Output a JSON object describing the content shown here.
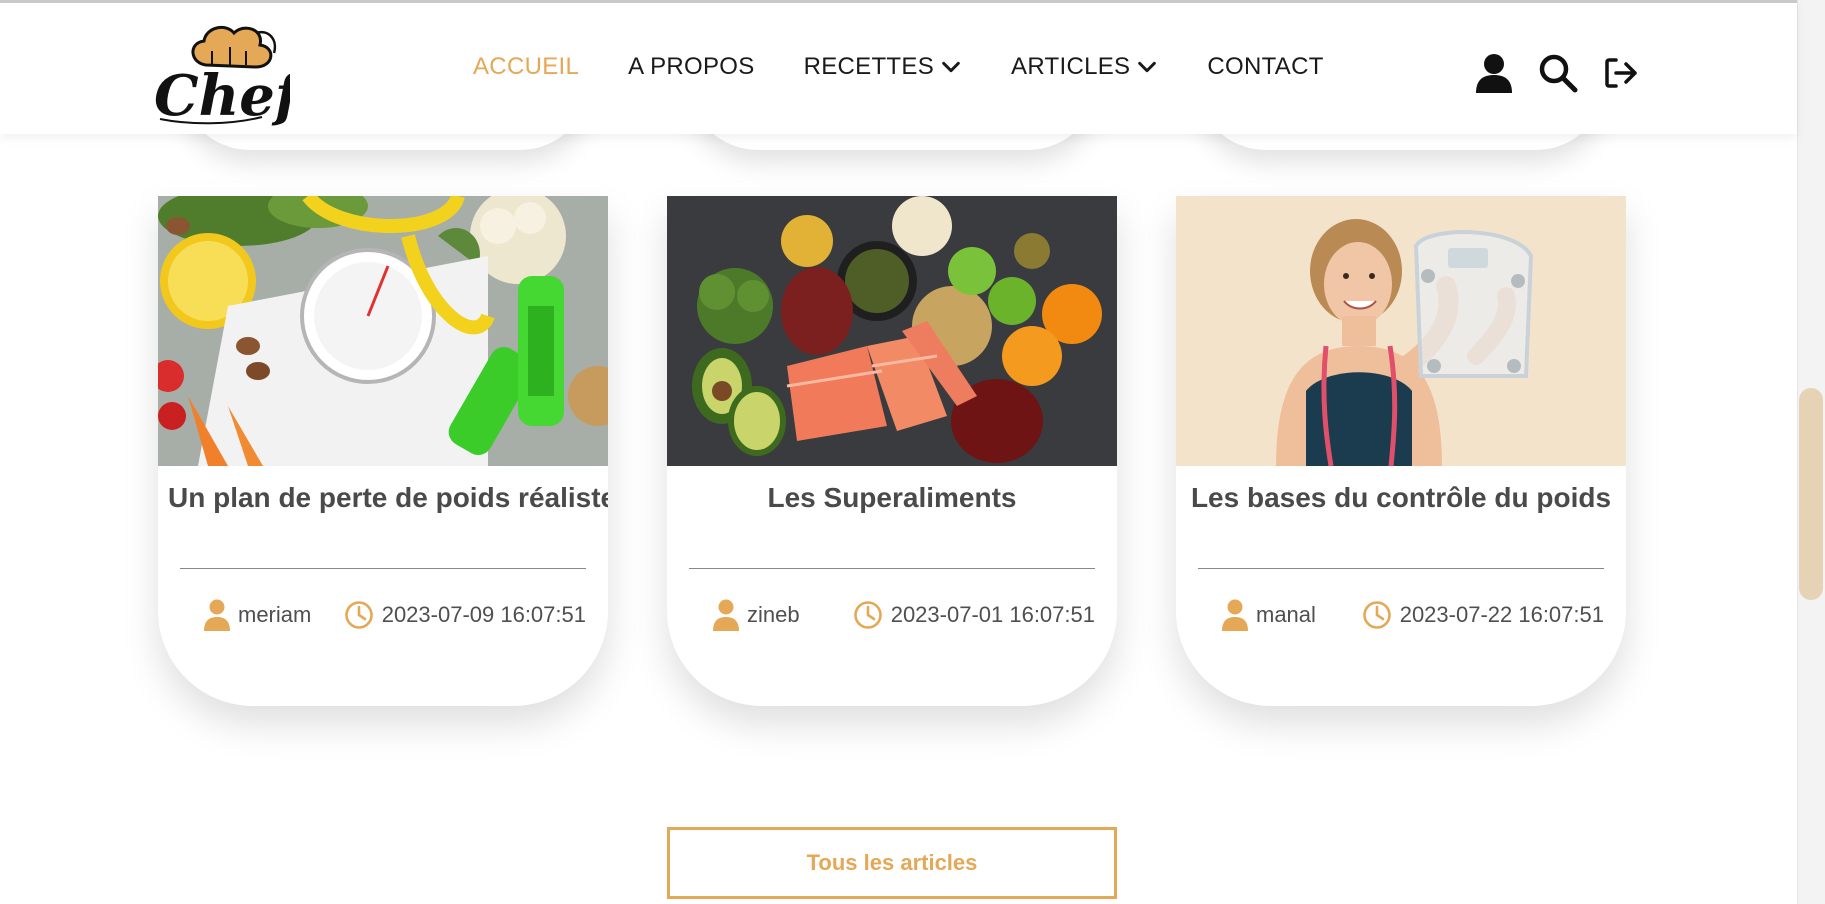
{
  "brand": {
    "logo_text": "Chef"
  },
  "nav": {
    "items": [
      {
        "label": "ACCUEIL",
        "active": true,
        "has_dropdown": false
      },
      {
        "label": "A PROPOS",
        "active": false,
        "has_dropdown": false
      },
      {
        "label": "RECETTES",
        "active": false,
        "has_dropdown": true
      },
      {
        "label": "ARTICLES",
        "active": false,
        "has_dropdown": true
      },
      {
        "label": "CONTACT",
        "active": false,
        "has_dropdown": false
      }
    ]
  },
  "header_icons": [
    "user-icon",
    "search-icon",
    "logout-icon"
  ],
  "articles": [
    {
      "title": "Un plan de perte de poids réaliste",
      "author": "meriam",
      "date": "2023-07-09 16:07:51"
    },
    {
      "title": "Les Superaliments",
      "author": "zineb",
      "date": "2023-07-01 16:07:51"
    },
    {
      "title": "Les bases du contrôle du poids",
      "author": "manal",
      "date": "2023-07-22 16:07:51"
    }
  ],
  "buttons": {
    "all_articles": "Tous les articles"
  },
  "colors": {
    "accent": "#e4a857",
    "text_dark": "#1a1a1a",
    "card_text": "#4a4a4a"
  }
}
